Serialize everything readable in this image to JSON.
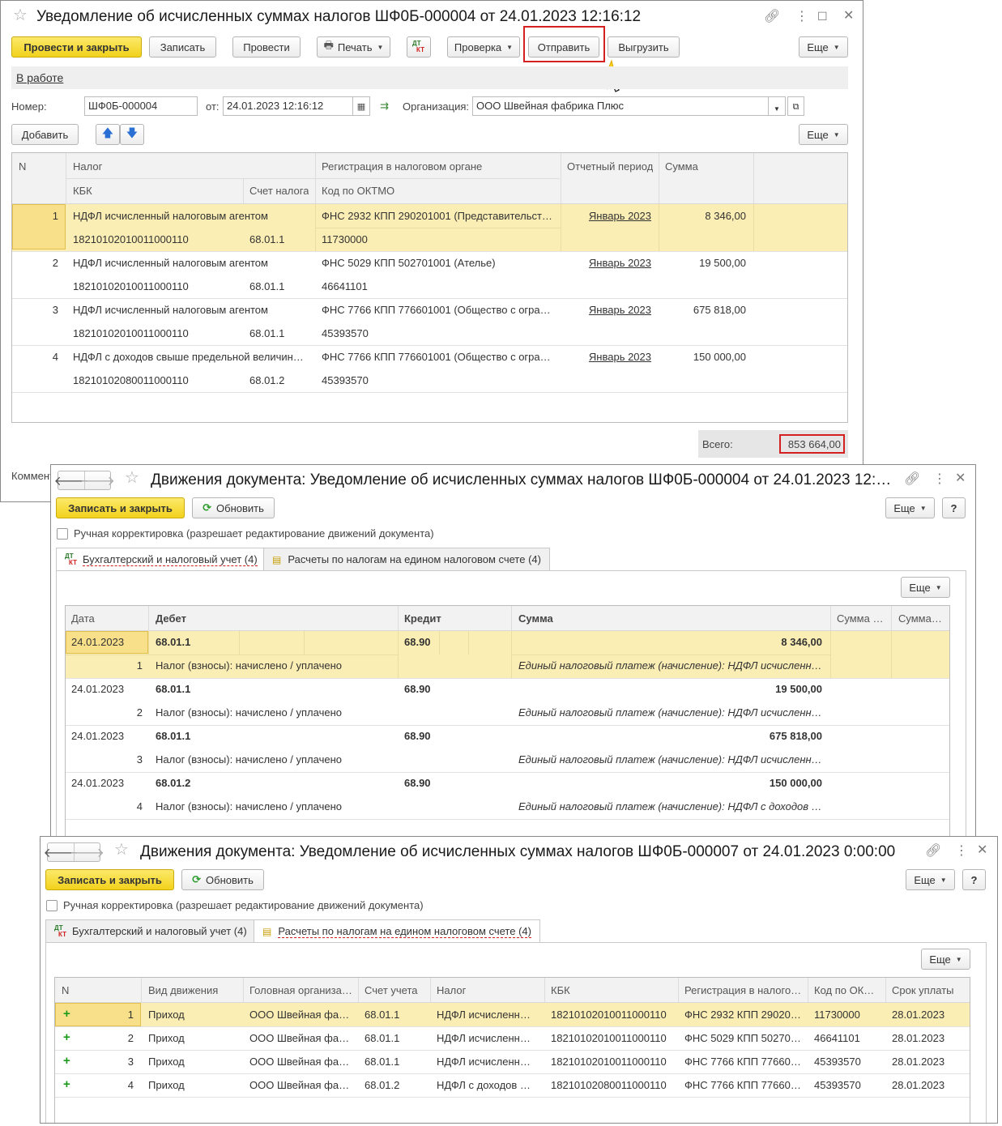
{
  "w1": {
    "title": "Уведомление об исчисленных суммах налогов ШФ0Б-000004 от 24.01.2023 12:16:12",
    "btn_post_close": "Провести и закрыть",
    "btn_save": "Записать",
    "btn_post": "Провести",
    "btn_print": "Печать",
    "btn_check": "Проверка",
    "btn_send": "Отправить",
    "btn_export": "Выгрузить",
    "btn_more": "Еще",
    "status_link": "В работе",
    "number_label": "Номер:",
    "number_value": "ШФ0Б-000004",
    "date_label": "от:",
    "date_value": "24.01.2023 12:16:12",
    "org_label": "Организация:",
    "org_value": "ООО Швейная фабрика Плюс",
    "btn_add": "Добавить",
    "btn_more2": "Еще",
    "headers": {
      "n": "N",
      "tax": "Налог",
      "reg": "Регистрация в налоговом органе",
      "period": "Отчетный период",
      "sum": "Сумма",
      "kbk": "КБК",
      "account": "Счет налога",
      "oktmo": "Код по ОКТМО"
    },
    "rows": [
      {
        "n": "1",
        "tax": "НДФЛ исчисленный налоговым агентом",
        "reg": "ФНС 2932 КПП 290201001 (Представительст…",
        "period": "Январь 2023",
        "sum": "8 346,00",
        "kbk": "18210102010011000110",
        "account": "68.01.1",
        "oktmo": "11730000"
      },
      {
        "n": "2",
        "tax": "НДФЛ исчисленный налоговым агентом",
        "reg": "ФНС 5029 КПП 502701001 (Ателье)",
        "period": "Январь 2023",
        "sum": "19 500,00",
        "kbk": "18210102010011000110",
        "account": "68.01.1",
        "oktmo": "46641101"
      },
      {
        "n": "3",
        "tax": "НДФЛ исчисленный налоговым агентом",
        "reg": "ФНС 7766 КПП 776601001 (Общество с огра…",
        "period": "Январь 2023",
        "sum": "675 818,00",
        "kbk": "18210102010011000110",
        "account": "68.01.1",
        "oktmo": "45393570"
      },
      {
        "n": "4",
        "tax": "НДФЛ с доходов свыше предельной величин…",
        "reg": "ФНС 7766 КПП 776601001 (Общество с огра…",
        "period": "Январь 2023",
        "sum": "150 000,00",
        "kbk": "18210102080011000110",
        "account": "68.01.2",
        "oktmo": "45393570"
      }
    ],
    "total_label": "Всего:",
    "total_value": "853 664,00",
    "comment_label": "Коммент"
  },
  "w2": {
    "title": "Движения документа: Уведомление об исчисленных суммах налогов ШФ0Б-000004 от 24.01.2023 12:…",
    "btn_save_close": "Записать и закрыть",
    "btn_refresh": "Обновить",
    "btn_more": "Еще",
    "btn_help": "?",
    "manual_label": "Ручная корректировка (разрешает редактирование движений документа)",
    "tab1": "Бухгалтерский и налоговый учет (4)",
    "tab2": "Расчеты по налогам на едином налоговом счете (4)",
    "btn_more2": "Еще",
    "headers": {
      "date": "Дата",
      "debit": "Дебет",
      "credit": "Кредит",
      "sum": "Сумма",
      "sum2": "Сумма …",
      "sum3": "Сумма…"
    },
    "rows": [
      {
        "date": "24.01.2023",
        "debit": "68.01.1",
        "credit": "68.90",
        "sum": "8 346,00",
        "n": "1",
        "content": "Налог (взносы): начислено / уплачено",
        "desc": "Единый налоговый платеж (начисление): НДФЛ исчисленн…"
      },
      {
        "date": "24.01.2023",
        "debit": "68.01.1",
        "credit": "68.90",
        "sum": "19 500,00",
        "n": "2",
        "content": "Налог (взносы): начислено / уплачено",
        "desc": "Единый налоговый платеж (начисление): НДФЛ исчисленн…"
      },
      {
        "date": "24.01.2023",
        "debit": "68.01.1",
        "credit": "68.90",
        "sum": "675 818,00",
        "n": "3",
        "content": "Налог (взносы): начислено / уплачено",
        "desc": "Единый налоговый платеж (начисление): НДФЛ исчисленн…"
      },
      {
        "date": "24.01.2023",
        "debit": "68.01.2",
        "credit": "68.90",
        "sum": "150 000,00",
        "n": "4",
        "content": "Налог (взносы): начислено / уплачено",
        "desc": "Единый налоговый платеж (начисление): НДФЛ с доходов …"
      }
    ]
  },
  "w3": {
    "title": "Движения документа: Уведомление об исчисленных суммах налогов ШФ0Б-000007 от 24.01.2023 0:00:00",
    "btn_save_close": "Записать и закрыть",
    "btn_refresh": "Обновить",
    "btn_more": "Еще",
    "btn_help": "?",
    "manual_label": "Ручная корректировка (разрешает редактирование движений документа)",
    "tab1": "Бухгалтерский и налоговый учет (4)",
    "tab2": "Расчеты по налогам на едином налоговом счете (4)",
    "btn_more2": "Еще",
    "headers": {
      "n": "N",
      "kind": "Вид движения",
      "org": "Головная организа…",
      "acc": "Счет учета",
      "tax": "Налог",
      "kbk": "КБК",
      "reg": "Регистрация в налого…",
      "oktmo": "Код по ОК…",
      "due": "Срок уплаты"
    },
    "rows": [
      {
        "n": "1",
        "kind": "Приход",
        "org": "ООО Швейная фа…",
        "acc": "68.01.1",
        "tax": "НДФЛ исчисленн…",
        "kbk": "18210102010011000110",
        "reg": "ФНС 2932 КПП 29020…",
        "oktmo": "11730000",
        "due": "28.01.2023"
      },
      {
        "n": "2",
        "kind": "Приход",
        "org": "ООО Швейная фа…",
        "acc": "68.01.1",
        "tax": "НДФЛ исчисленн…",
        "kbk": "18210102010011000110",
        "reg": "ФНС 5029 КПП 50270…",
        "oktmo": "46641101",
        "due": "28.01.2023"
      },
      {
        "n": "3",
        "kind": "Приход",
        "org": "ООО Швейная фа…",
        "acc": "68.01.1",
        "tax": "НДФЛ исчисленн…",
        "kbk": "18210102010011000110",
        "reg": "ФНС 7766 КПП 77660…",
        "oktmo": "45393570",
        "due": "28.01.2023"
      },
      {
        "n": "4",
        "kind": "Приход",
        "org": "ООО Швейная фа…",
        "acc": "68.01.2",
        "tax": "НДФЛ с доходов …",
        "kbk": "18210102080011000110",
        "reg": "ФНС 7766 КПП 77660…",
        "oktmo": "45393570",
        "due": "28.01.2023"
      }
    ]
  },
  "icons": {
    "star": "star-icon",
    "link": "link-icon",
    "kebab": "more-vert-icon",
    "close": "close-icon",
    "printer": "printer-icon"
  },
  "colors": {
    "accent_yellow": "#f2d21c",
    "selected_row": "#fbeeb4",
    "highlight_red": "#d42020"
  }
}
